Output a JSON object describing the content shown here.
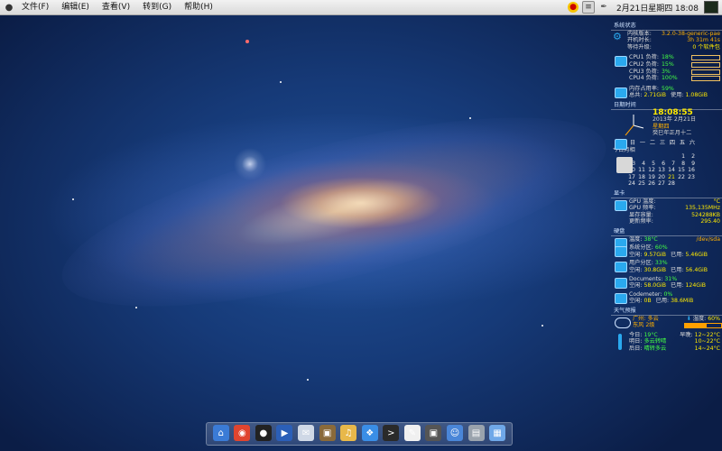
{
  "menubar": {
    "items": [
      {
        "label": "文件(F)"
      },
      {
        "label": "编辑(E)"
      },
      {
        "label": "查看(V)"
      },
      {
        "label": "转到(G)"
      },
      {
        "label": "帮助(H)"
      }
    ],
    "clock": "2月21日星期四 18:08"
  },
  "conky": {
    "system": {
      "title": "系统状态",
      "kernel_label": "内核版本:",
      "kernel_value": "3.2.0-38-generic-pae",
      "uptime_label": "开机时长:",
      "uptime_value": "3h 31m 41s",
      "updates_label": "等待升级:",
      "updates_value": "0 个软件包"
    },
    "cpu": [
      {
        "label": "CPU1 负荷:",
        "value": "18%"
      },
      {
        "label": "CPU2 负荷:",
        "value": "15%"
      },
      {
        "label": "CPU3 负荷:",
        "value": "3%"
      },
      {
        "label": "CPU4 负荷:",
        "value": "100%"
      }
    ],
    "memory": {
      "usage_label": "内存占用率:",
      "usage_value": "59%",
      "total_label": "总共:",
      "total_value": "2.71GiB",
      "used_label": "使用:",
      "used_value": "1.08GiB"
    },
    "datetime": {
      "title": "日期时间",
      "time": "18:08:55",
      "date": "2013年 2月21日",
      "weekday": "星期四",
      "lunar": "癸巳年正月十二",
      "weekdays": [
        "日",
        "一",
        "二",
        "三",
        "四",
        "五",
        "六"
      ],
      "days": [
        "",
        "",
        "",
        "",
        "",
        "1",
        "2",
        "3",
        "4",
        "5",
        "6",
        "7",
        "8",
        "9",
        "10",
        "11",
        "12",
        "13",
        "14",
        "15",
        "16",
        "17",
        "18",
        "19",
        "20",
        "21",
        "22",
        "23",
        "24",
        "25",
        "26",
        "27",
        "28",
        "",
        ""
      ],
      "today": "21",
      "moon_label": "今日月相"
    },
    "gpu": {
      "title": "显卡",
      "temp_label": "GPU 温度:",
      "temp_value": "°C",
      "freq_label": "GPU 频率:",
      "freq_value": "135,135MHz",
      "mem_label": "显存容量:",
      "mem_value": "524288KB",
      "rate_label": "更新频率:",
      "rate_value": "295.40"
    },
    "disk": {
      "title": "硬盘",
      "temp_label": "温度:",
      "temp_value": "38°C",
      "device": "/dev/sda",
      "partitions": [
        {
          "name": "系统分区:",
          "pct": "60%",
          "free": "9.57GiB",
          "used": "5.46GiB"
        },
        {
          "name": "用户分区:",
          "pct": "33%",
          "free": "30.8GiB",
          "used": "56.4GiB"
        },
        {
          "name": "Documents:",
          "pct": "31%",
          "free": "58.0GiB",
          "used": "124GiB"
        },
        {
          "name": "Codemeter:",
          "pct": "0%",
          "free": "0B",
          "used": "38.6MiB"
        }
      ],
      "free_label": "空闲:",
      "used_label": "已用:"
    },
    "weather": {
      "title": "天气预报",
      "city": "广州: 多云",
      "wind": "东风 2级",
      "humidity_label": "湿度:",
      "humidity_value": "60%",
      "humidity_fraction": 0.6,
      "forecast": [
        {
          "day": "今日:",
          "temp": "19°C",
          "extra_label": "早晚:",
          "extra": "12~22°C"
        },
        {
          "day": "明日:",
          "temp": "多云转晴",
          "extra_label": "",
          "extra": "10~22°C"
        },
        {
          "day": "后日:",
          "temp": "晴转多云",
          "extra_label": "",
          "extra": "14~24°C"
        }
      ]
    }
  },
  "dock": {
    "icons": [
      "home-folder-icon",
      "chrome-icon",
      "qq-icon",
      "media-player-icon",
      "mail-icon",
      "photos-icon",
      "music-icon",
      "safari-icon",
      "terminal-icon",
      "text-editor-icon",
      "monitor-icon",
      "finder-icon",
      "trash-icon",
      "files-icon"
    ]
  }
}
